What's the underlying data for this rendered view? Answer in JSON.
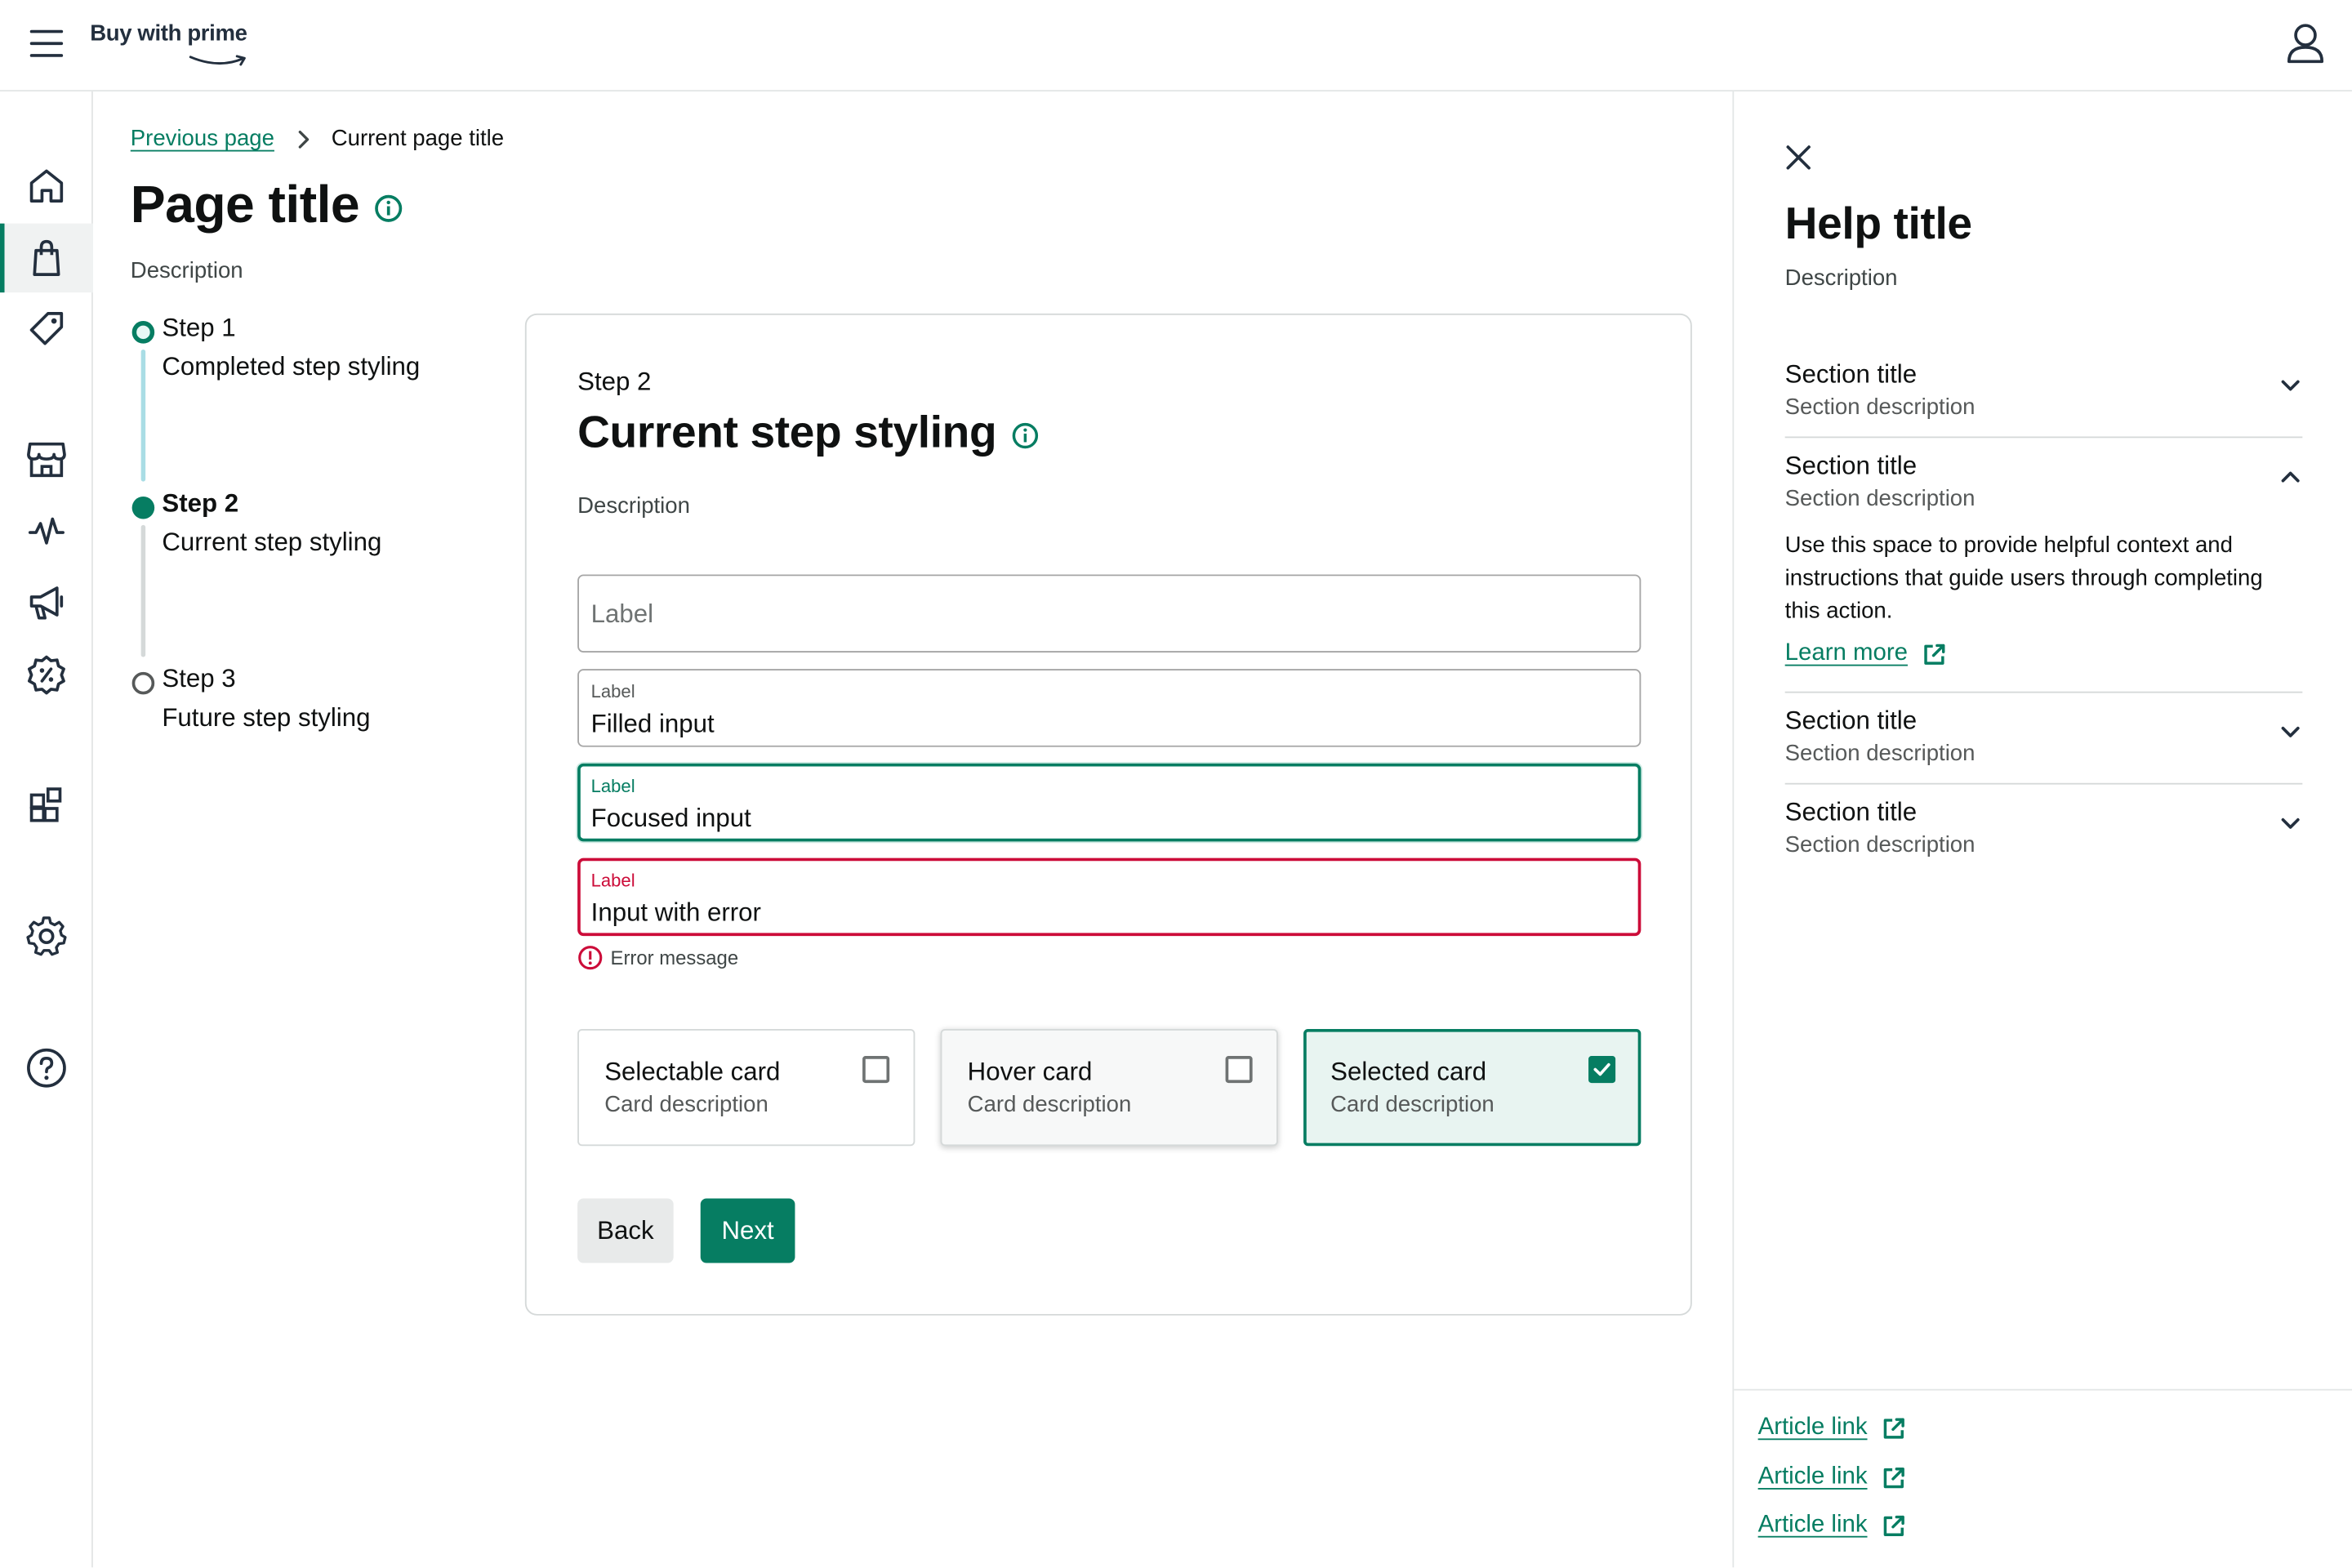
{
  "app": {
    "brand": "Buy with prime",
    "colors": {
      "accent": "#067d62",
      "error": "#cc0c39",
      "text": "#0f1111",
      "muted": "#565959"
    }
  },
  "nav": {
    "items": [
      {
        "icon": "home-icon"
      },
      {
        "icon": "shopping-bag-icon",
        "active": true
      },
      {
        "icon": "tag-icon"
      },
      {
        "icon": "storefront-icon"
      },
      {
        "icon": "activity-icon"
      },
      {
        "icon": "megaphone-icon"
      },
      {
        "icon": "badge-percent-icon"
      },
      {
        "icon": "widgets-icon"
      },
      {
        "icon": "gear-icon"
      },
      {
        "icon": "help-icon"
      }
    ]
  },
  "breadcrumb": {
    "previous": "Previous page",
    "current": "Current page title"
  },
  "page": {
    "title": "Page title",
    "description": "Description"
  },
  "stepper": {
    "steps": [
      {
        "number": "Step 1",
        "label": "Completed step styling",
        "state": "completed"
      },
      {
        "number": "Step 2",
        "label": "Current step styling",
        "state": "current"
      },
      {
        "number": "Step 3",
        "label": "Future step styling",
        "state": "future"
      }
    ]
  },
  "form": {
    "step_label": "Step 2",
    "title": "Current step styling",
    "description": "Description",
    "fields": {
      "empty": {
        "placeholder": "Label"
      },
      "filled": {
        "label": "Label",
        "value": "Filled input"
      },
      "focused": {
        "label": "Label",
        "value": "Focused input"
      },
      "error": {
        "label": "Label",
        "value": "Input with error",
        "message": "Error message"
      }
    },
    "cards": [
      {
        "title": "Selectable card",
        "description": "Card description",
        "state": "default",
        "checked": false
      },
      {
        "title": "Hover card",
        "description": "Card description",
        "state": "hover",
        "checked": false
      },
      {
        "title": "Selected card",
        "description": "Card description",
        "state": "selected",
        "checked": true
      }
    ],
    "back_label": "Back",
    "next_label": "Next"
  },
  "help": {
    "title": "Help title",
    "description": "Description",
    "sections": [
      {
        "title": "Section title",
        "description": "Section description",
        "expanded": false
      },
      {
        "title": "Section title",
        "description": "Section description",
        "expanded": true,
        "body": "Use this space to provide helpful context and instructions that guide users through completing this action.",
        "link": "Learn more"
      },
      {
        "title": "Section title",
        "description": "Section description",
        "expanded": false
      },
      {
        "title": "Section title",
        "description": "Section description",
        "expanded": false
      }
    ],
    "articles": [
      "Article link",
      "Article link",
      "Article link"
    ]
  }
}
